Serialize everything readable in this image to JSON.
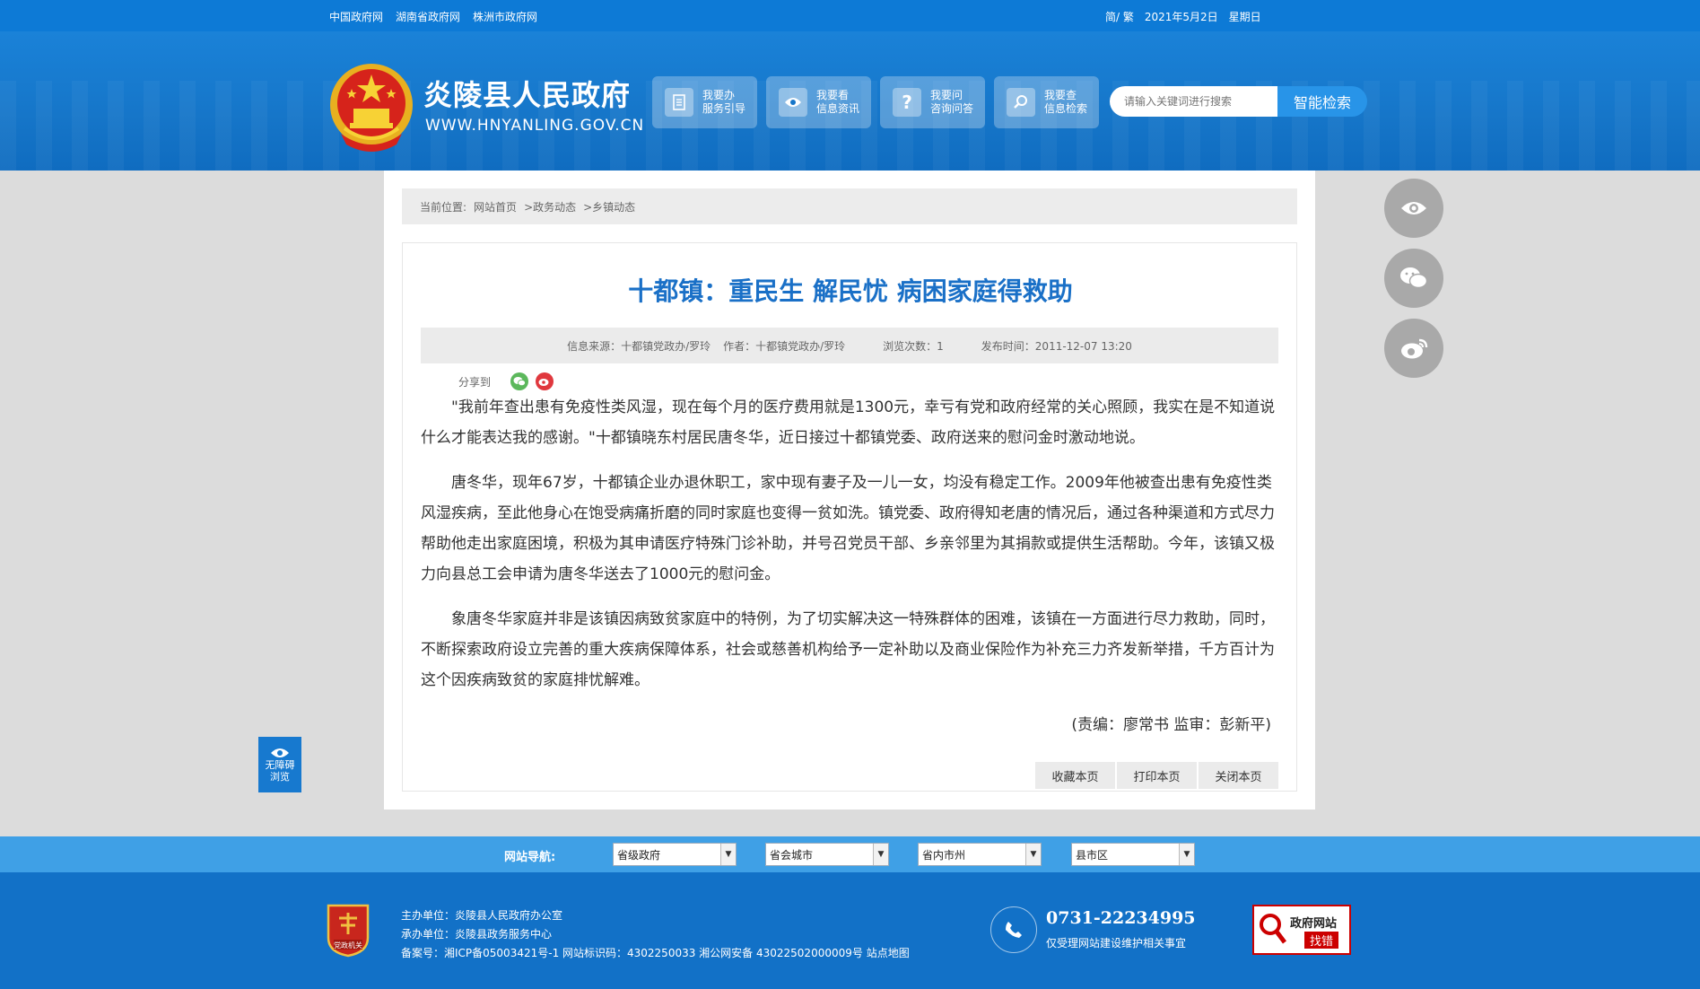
{
  "topbar": {
    "links": [
      "中国政府网",
      "湖南省政府网",
      "株洲市政府网"
    ],
    "lang": "简/ 繁",
    "date": "2021年5月2日",
    "weekday": "星期日"
  },
  "header": {
    "site_title": "炎陵县人民政府",
    "site_domain": "WWW.HNYANLING.GOV.CN",
    "quick_buttons": [
      {
        "line1": "我要办",
        "line2": "服务引导",
        "icon": "document-icon"
      },
      {
        "line1": "我要看",
        "line2": "信息资讯",
        "icon": "eye-icon"
      },
      {
        "line1": "我要问",
        "line2": "咨询问答",
        "icon": "question-icon"
      },
      {
        "line1": "我要查",
        "line2": "信息检索",
        "icon": "search-icon"
      }
    ],
    "search_placeholder": "请输入关键词进行搜索",
    "search_button": "智能检索"
  },
  "breadcrumb": {
    "label": "当前位置:",
    "items": [
      "网站首页",
      ">政务动态",
      ">乡镇动态"
    ]
  },
  "article": {
    "title": "十都镇：重民生 解民忧 病困家庭得救助",
    "meta": {
      "source": "信息来源：十都镇党政办/罗玲",
      "author": "作者：十都镇党政办/罗玲",
      "views": "浏览次数：1",
      "published": "发布时间：2011-12-07 13:20"
    },
    "share_label": "分享到",
    "paragraphs": [
      "\"我前年查出患有免疫性类风湿，现在每个月的医疗费用就是1300元，幸亏有党和政府经常的关心照顾，我实在是不知道说什么才能表达我的感谢。\"十都镇晓东村居民唐冬华，近日接过十都镇党委、政府送来的慰问金时激动地说。",
      "唐冬华，现年67岁，十都镇企业办退休职工，家中现有妻子及一儿一女，均没有稳定工作。2009年他被查出患有免疫性类风湿疾病，至此他身心在饱受病痛折磨的同时家庭也变得一贫如洗。镇党委、政府得知老唐的情况后，通过各种渠道和方式尽力帮助他走出家庭困境，积极为其申请医疗特殊门诊补助，并号召党员干部、乡亲邻里为其捐款或提供生活帮助。今年，该镇又极力向县总工会申请为唐冬华送去了1000元的慰问金。",
      "象唐冬华家庭并非是该镇因病致贫家庭中的特例，为了切实解决这一特殊群体的困难，该镇在一方面进行尽力救助，同时，不断探索政府设立完善的重大疾病保障体系，社会或慈善机构给予一定补助以及商业保险作为补充三力齐发新举措，千方百计为这个因疾病致贫的家庭排忧解难。"
    ],
    "editor": "(责编：廖常书  监审：彭新平)",
    "actions": [
      "收藏本页",
      "打印本页",
      "关闭本页"
    ]
  },
  "accessibility": {
    "line1": "无障碍",
    "line2": "浏览"
  },
  "footer_nav": {
    "label": "网站导航:",
    "selects": [
      "省级政府",
      "省会城市",
      "省内市州",
      "县市区"
    ]
  },
  "footer": {
    "host": "主办单位：炎陵县人民政府办公室",
    "organizer": "承办单位：炎陵县政务服务中心",
    "record": "备案号：湘ICP备05003421号-1 网站标识码：4302250033 湘公网安备 43022502000009号 站点地图",
    "phone": "0731-22234995",
    "phone_note": "仅受理网站建设维护相关事宜",
    "err_line1": "政府网站",
    "err_line2": "找错",
    "badge_text": "党政机关"
  },
  "colors": {
    "primary": "#1676c9",
    "title_blue": "#1a70c7",
    "wechat": "#5cb85c",
    "weibo": "#e0383e"
  }
}
